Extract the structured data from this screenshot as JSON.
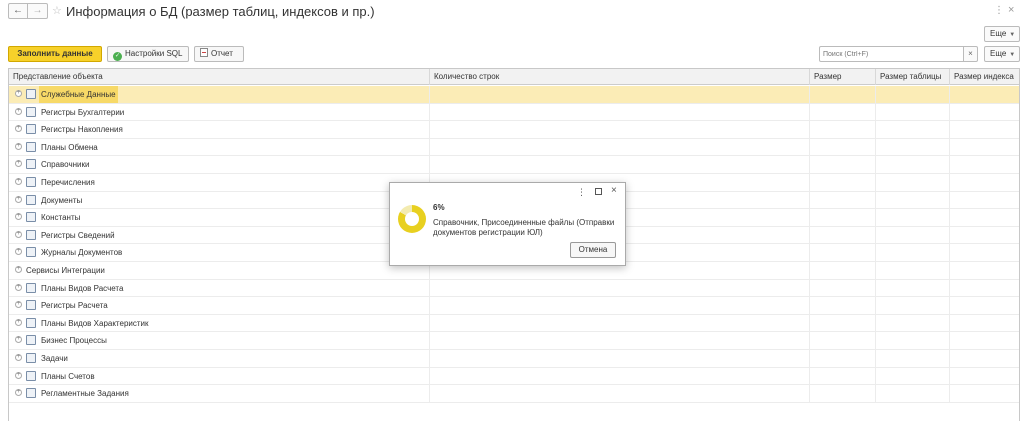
{
  "header": {
    "title": "Информация о БД (размер таблиц, индексов и пр.)",
    "back_icon": "←",
    "forward_icon": "→",
    "favorite_icon": "☆",
    "menu_icon": "⋮",
    "close_icon": "×",
    "more_label": "Еще"
  },
  "toolbar": {
    "fill_label": "Заполнить данные",
    "sql_label": "Настройки SQL",
    "report_label": "Отчет",
    "search_placeholder": "Поиск (Ctrl+F)",
    "clear_icon": "×",
    "more_label": "Еще",
    "accent_color": "#f7d12a"
  },
  "table": {
    "columns": [
      "Представление объекта",
      "Количество строк",
      "Размер",
      "Размер таблицы",
      "Размер индекса"
    ],
    "rows": [
      {
        "label": "Служебные Данные",
        "icon": "service-data-icon",
        "selected": true
      },
      {
        "label": "Регистры Бухгалтерии",
        "icon": "accounting-register-icon"
      },
      {
        "label": "Регистры Накопления",
        "icon": "accumulation-register-icon"
      },
      {
        "label": "Планы Обмена",
        "icon": "exchange-plan-icon"
      },
      {
        "label": "Справочники",
        "icon": "catalog-icon"
      },
      {
        "label": "Перечисления",
        "icon": "enum-icon"
      },
      {
        "label": "Документы",
        "icon": "document-icon"
      },
      {
        "label": "Константы",
        "icon": "constant-icon"
      },
      {
        "label": "Регистры Сведений",
        "icon": "info-register-icon"
      },
      {
        "label": "Журналы Документов",
        "icon": "document-journal-icon"
      },
      {
        "label": "Сервисы Интеграции",
        "icon": null
      },
      {
        "label": "Планы Видов Расчета",
        "icon": "calculation-types-plan-icon"
      },
      {
        "label": "Регистры Расчета",
        "icon": "calculation-register-icon"
      },
      {
        "label": "Планы Видов Характеристик",
        "icon": "characteristic-types-plan-icon"
      },
      {
        "label": "Бизнес Процессы",
        "icon": "business-process-icon"
      },
      {
        "label": "Задачи",
        "icon": "task-icon"
      },
      {
        "label": "Планы Счетов",
        "icon": "chart-of-accounts-icon"
      },
      {
        "label": "Регламентные Задания",
        "icon": "scheduled-job-icon"
      }
    ]
  },
  "progress_dialog": {
    "percent": "6%",
    "percent_value": 6,
    "message": "Справочник, Присоединенные файлы (Отправки документов регистрации ЮЛ)",
    "cancel_label": "Отмена",
    "menu_icon": "⋮",
    "close_icon": "×"
  }
}
